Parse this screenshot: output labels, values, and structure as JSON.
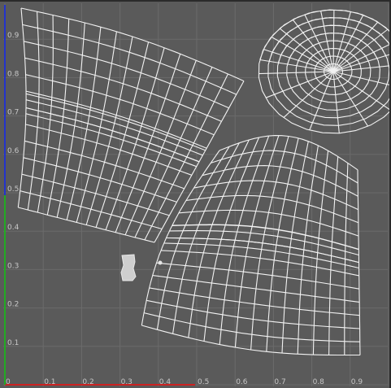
{
  "editor": {
    "x_axis_labels": [
      "0",
      "0.1",
      "0.2",
      "0.3",
      "0.4",
      "0.5",
      "0.6",
      "0.7",
      "0.8",
      "0.9"
    ],
    "y_axis_labels": [
      "0.1",
      "0.2",
      "0.3",
      "0.4",
      "0.5",
      "0.6",
      "0.7",
      "0.8",
      "0.9"
    ],
    "colors": {
      "background": "#5a5a5a",
      "grid": "#6b6b6b",
      "wire": "#f2f2f2",
      "u_axis": "#cc2222",
      "v_axis_lower": "#22aa22",
      "v_axis_upper": "#2233cc",
      "label": "#c8c8c8",
      "selected_island": "#cfcfcf"
    }
  }
}
